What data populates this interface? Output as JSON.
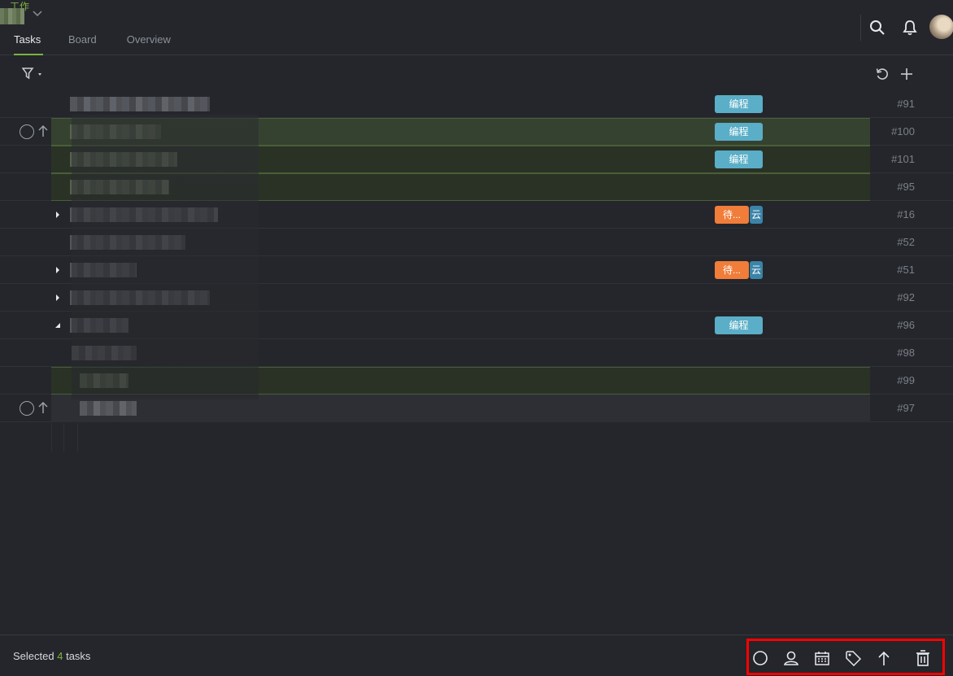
{
  "project": {
    "name": "工作"
  },
  "tabs": [
    {
      "label": "Tasks",
      "active": true
    },
    {
      "label": "Board",
      "active": false
    },
    {
      "label": "Overview",
      "active": false
    }
  ],
  "header_icons": [
    "search-icon",
    "bell-icon"
  ],
  "toolbar_icons": [
    "filter-icon",
    "refresh-icon",
    "plus-icon"
  ],
  "colors": {
    "accent": "#7cb342",
    "tag_blue": "#5aaec7",
    "tag_orange": "#f07d3a",
    "tag_teal": "#3b84a8",
    "selection": "#2a3226"
  },
  "rows": [
    {
      "num": "#91",
      "tags": [
        {
          "label": "编程",
          "color": "blue"
        }
      ]
    },
    {
      "num": "#100",
      "tags": [
        {
          "label": "编程",
          "color": "blue"
        }
      ],
      "selected": true
    },
    {
      "num": "#101",
      "tags": [
        {
          "label": "编程",
          "color": "blue"
        }
      ],
      "selected": true
    },
    {
      "num": "#95",
      "tags": [],
      "selected": true
    },
    {
      "num": "#16",
      "tags": [
        {
          "label": "待...",
          "color": "orange"
        },
        {
          "label": "云",
          "color": "teal"
        }
      ]
    },
    {
      "num": "#52",
      "tags": []
    },
    {
      "num": "#51",
      "tags": [
        {
          "label": "待...",
          "color": "orange"
        },
        {
          "label": "云",
          "color": "teal"
        }
      ]
    },
    {
      "num": "#92",
      "tags": []
    },
    {
      "num": "#96",
      "tags": [
        {
          "label": "编程",
          "color": "blue"
        }
      ]
    },
    {
      "num": "#98",
      "tags": []
    },
    {
      "num": "#99",
      "tags": [],
      "selected": true
    },
    {
      "num": "#97",
      "tags": []
    }
  ],
  "bottom": {
    "selected_prefix": "Selected",
    "selected_count": "4",
    "selected_suffix": "tasks",
    "actions": [
      "status-icon",
      "assignee-icon",
      "calendar-icon",
      "tag-icon",
      "priority-icon",
      "trash-icon"
    ]
  }
}
